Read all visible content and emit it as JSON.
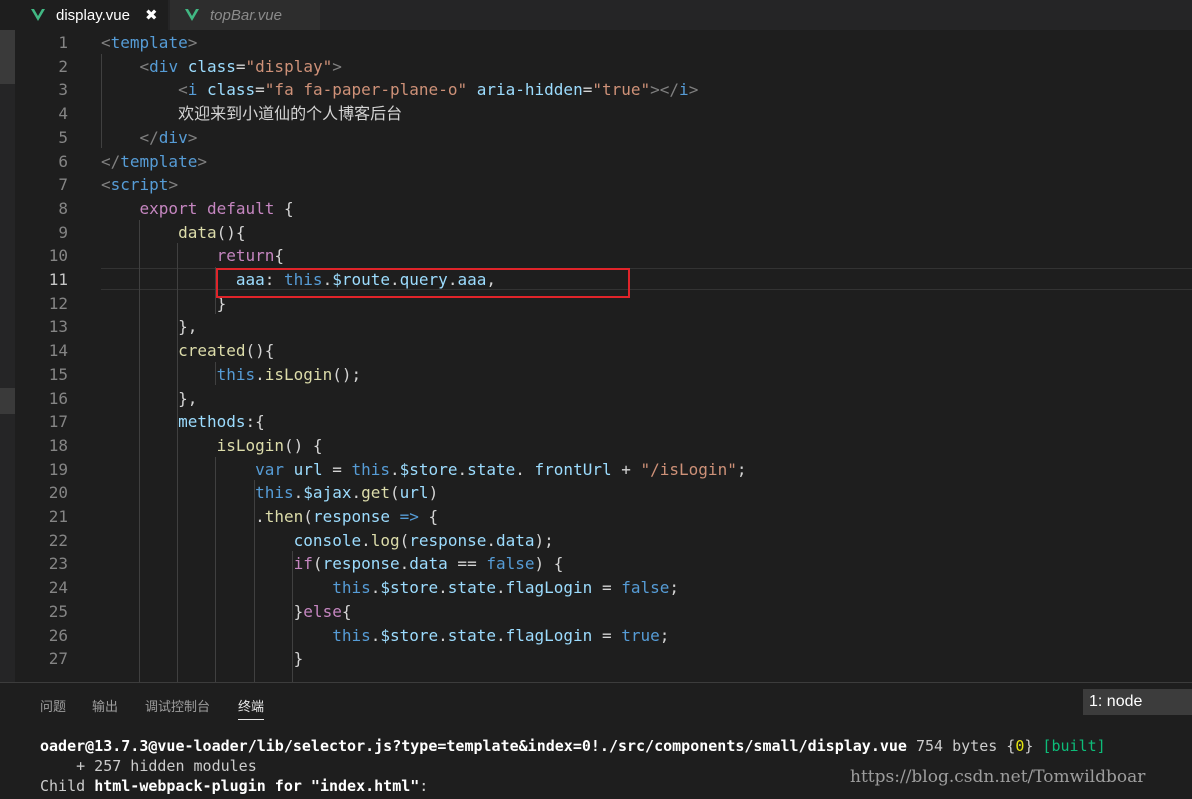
{
  "tabs": [
    {
      "label": "display.vue",
      "close": "✖"
    },
    {
      "label": "topBar.vue"
    }
  ],
  "colors": {
    "vue_green": "#41b883",
    "highlight": "#e0242a"
  },
  "editor": {
    "current_line": "11",
    "line_numbers": [
      "1",
      "2",
      "3",
      "4",
      "5",
      "6",
      "7",
      "8",
      "9",
      "10",
      "11",
      "12",
      "13",
      "14",
      "15",
      "16",
      "17",
      "18",
      "19",
      "20",
      "21",
      "22",
      "23",
      "24",
      "25",
      "26",
      "27"
    ],
    "lines": [
      [
        [
          "t-brk",
          "<"
        ],
        [
          "t-tag",
          "template"
        ],
        [
          "t-brk",
          ">"
        ]
      ],
      [
        [
          "t-pl",
          "    "
        ],
        [
          "t-brk",
          "<"
        ],
        [
          "t-tag",
          "div"
        ],
        [
          "t-pl",
          " "
        ],
        [
          "t-attr",
          "class"
        ],
        [
          "t-pl",
          "="
        ],
        [
          "t-str",
          "\"display\""
        ],
        [
          "t-brk",
          ">"
        ]
      ],
      [
        [
          "t-pl",
          "        "
        ],
        [
          "t-brk",
          "<"
        ],
        [
          "t-tag",
          "i"
        ],
        [
          "t-pl",
          " "
        ],
        [
          "t-attr",
          "class"
        ],
        [
          "t-pl",
          "="
        ],
        [
          "t-str",
          "\"fa fa-paper-plane-o\""
        ],
        [
          "t-pl",
          " "
        ],
        [
          "t-attr",
          "aria-hidden"
        ],
        [
          "t-pl",
          "="
        ],
        [
          "t-str",
          "\"true\""
        ],
        [
          "t-brk",
          "></"
        ],
        [
          "t-tag",
          "i"
        ],
        [
          "t-brk",
          ">"
        ]
      ],
      [
        [
          "t-pl",
          "        "
        ],
        [
          "t-txt",
          "欢迎来到小道仙的个人博客后台"
        ]
      ],
      [
        [
          "t-pl",
          "    "
        ],
        [
          "t-brk",
          "</"
        ],
        [
          "t-tag",
          "div"
        ],
        [
          "t-brk",
          ">"
        ]
      ],
      [
        [
          "t-brk",
          "</"
        ],
        [
          "t-tag",
          "template"
        ],
        [
          "t-brk",
          ">"
        ]
      ],
      [
        [
          "t-brk",
          "<"
        ],
        [
          "t-tag",
          "script"
        ],
        [
          "t-brk",
          ">"
        ]
      ],
      [
        [
          "t-pl",
          "    "
        ],
        [
          "t-kw",
          "export"
        ],
        [
          "t-pl",
          " "
        ],
        [
          "t-kw",
          "default"
        ],
        [
          "t-pl",
          " {"
        ]
      ],
      [
        [
          "t-pl",
          "        "
        ],
        [
          "t-fn",
          "data"
        ],
        [
          "t-pl",
          "(){"
        ]
      ],
      [
        [
          "t-pl",
          "            "
        ],
        [
          "t-kw",
          "return"
        ],
        [
          "t-pl",
          "{"
        ]
      ],
      [
        [
          "t-pl",
          "              "
        ],
        [
          "t-var",
          "aaa"
        ],
        [
          "t-pl",
          ": "
        ],
        [
          "t-st",
          "this"
        ],
        [
          "t-pl",
          "."
        ],
        [
          "t-var",
          "$route"
        ],
        [
          "t-pl",
          "."
        ],
        [
          "t-var",
          "query"
        ],
        [
          "t-pl",
          "."
        ],
        [
          "t-var",
          "aaa"
        ],
        [
          "t-pl",
          ","
        ]
      ],
      [
        [
          "t-pl",
          "            }"
        ]
      ],
      [
        [
          "t-pl",
          "        },"
        ]
      ],
      [
        [
          "t-pl",
          "        "
        ],
        [
          "t-fn",
          "created"
        ],
        [
          "t-pl",
          "(){"
        ]
      ],
      [
        [
          "t-pl",
          "            "
        ],
        [
          "t-st",
          "this"
        ],
        [
          "t-pl",
          "."
        ],
        [
          "t-fn",
          "isLogin"
        ],
        [
          "t-pl",
          "();"
        ]
      ],
      [
        [
          "t-pl",
          "        },"
        ]
      ],
      [
        [
          "t-pl",
          "        "
        ],
        [
          "t-var",
          "methods"
        ],
        [
          "t-pl",
          ":{"
        ]
      ],
      [
        [
          "t-pl",
          "            "
        ],
        [
          "t-fn",
          "isLogin"
        ],
        [
          "t-pl",
          "() {"
        ]
      ],
      [
        [
          "t-pl",
          "                "
        ],
        [
          "t-st",
          "var"
        ],
        [
          "t-pl",
          " "
        ],
        [
          "t-var",
          "url"
        ],
        [
          "t-pl",
          " = "
        ],
        [
          "t-st",
          "this"
        ],
        [
          "t-pl",
          "."
        ],
        [
          "t-var",
          "$store"
        ],
        [
          "t-pl",
          "."
        ],
        [
          "t-var",
          "state"
        ],
        [
          "t-pl",
          ". "
        ],
        [
          "t-var",
          "frontUrl"
        ],
        [
          "t-pl",
          " + "
        ],
        [
          "t-str",
          "\"/isLogin\""
        ],
        [
          "t-pl",
          ";"
        ]
      ],
      [
        [
          "t-pl",
          "                "
        ],
        [
          "t-st",
          "this"
        ],
        [
          "t-pl",
          "."
        ],
        [
          "t-var",
          "$ajax"
        ],
        [
          "t-pl",
          "."
        ],
        [
          "t-fn",
          "get"
        ],
        [
          "t-pl",
          "("
        ],
        [
          "t-var",
          "url"
        ],
        [
          "t-pl",
          ")"
        ]
      ],
      [
        [
          "t-pl",
          "                ."
        ],
        [
          "t-fn",
          "then"
        ],
        [
          "t-pl",
          "("
        ],
        [
          "t-var",
          "response"
        ],
        [
          "t-pl",
          " "
        ],
        [
          "t-st",
          "=>"
        ],
        [
          "t-pl",
          " {"
        ]
      ],
      [
        [
          "t-pl",
          "                    "
        ],
        [
          "t-var",
          "console"
        ],
        [
          "t-pl",
          "."
        ],
        [
          "t-fn",
          "log"
        ],
        [
          "t-pl",
          "("
        ],
        [
          "t-var",
          "response"
        ],
        [
          "t-pl",
          "."
        ],
        [
          "t-var",
          "data"
        ],
        [
          "t-pl",
          ");"
        ]
      ],
      [
        [
          "t-pl",
          "                    "
        ],
        [
          "t-kw",
          "if"
        ],
        [
          "t-pl",
          "("
        ],
        [
          "t-var",
          "response"
        ],
        [
          "t-pl",
          "."
        ],
        [
          "t-var",
          "data"
        ],
        [
          "t-pl",
          " == "
        ],
        [
          "t-st",
          "false"
        ],
        [
          "t-pl",
          ") {"
        ]
      ],
      [
        [
          "t-pl",
          "                        "
        ],
        [
          "t-st",
          "this"
        ],
        [
          "t-pl",
          "."
        ],
        [
          "t-var",
          "$store"
        ],
        [
          "t-pl",
          "."
        ],
        [
          "t-var",
          "state"
        ],
        [
          "t-pl",
          "."
        ],
        [
          "t-var",
          "flagLogin"
        ],
        [
          "t-pl",
          " = "
        ],
        [
          "t-st",
          "false"
        ],
        [
          "t-pl",
          ";"
        ]
      ],
      [
        [
          "t-pl",
          "                    }"
        ],
        [
          "t-kw",
          "else"
        ],
        [
          "t-pl",
          "{"
        ]
      ],
      [
        [
          "t-pl",
          "                        "
        ],
        [
          "t-st",
          "this"
        ],
        [
          "t-pl",
          "."
        ],
        [
          "t-var",
          "$store"
        ],
        [
          "t-pl",
          "."
        ],
        [
          "t-var",
          "state"
        ],
        [
          "t-pl",
          "."
        ],
        [
          "t-var",
          "flagLogin"
        ],
        [
          "t-pl",
          " = "
        ],
        [
          "t-st",
          "true"
        ],
        [
          "t-pl",
          ";"
        ]
      ],
      [
        [
          "t-pl",
          "                    }"
        ]
      ]
    ]
  },
  "panel": {
    "tabs": [
      "问题",
      "输出",
      "调试控制台",
      "终端"
    ],
    "active_tab": "终端",
    "terminal_select": "1: node",
    "terminal": {
      "line1_a": "oader@13.7.3@vue-loader/lib/selector.js?type=template&index=0!./src/components/small/display.vue",
      "line1_b": " 754 bytes {",
      "line1_c": "0",
      "line1_d": "} ",
      "line1_e": "[built]",
      "line2": "    + 257 hidden modules",
      "line3_a": "Child ",
      "line3_b": "html-webpack-plugin for \"index.html\"",
      "line3_c": ":"
    }
  },
  "watermark": "https://blog.csdn.net/Tomwildboar"
}
